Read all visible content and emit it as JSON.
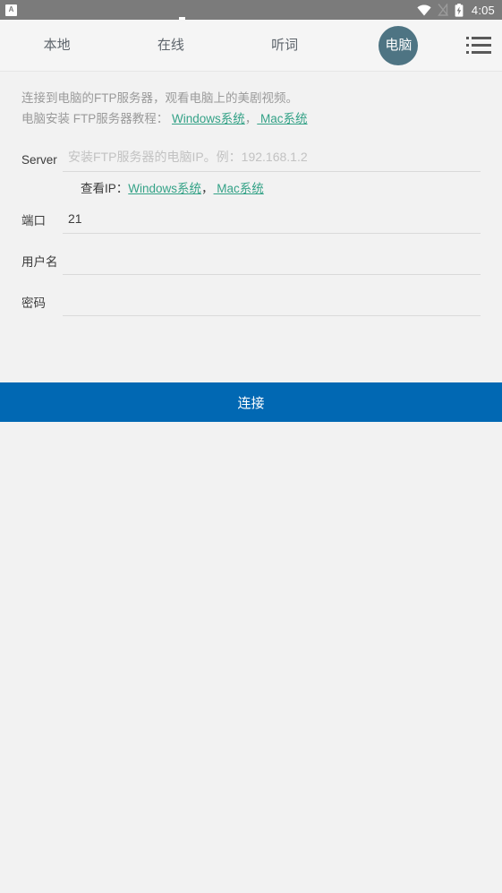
{
  "status_bar": {
    "app_icon": "app-notification-icon",
    "wifi_icon": "wifi-icon",
    "signal_icon": "signal-off-icon",
    "battery_icon": "battery-charging-icon",
    "time": "4:05"
  },
  "toolbar": {
    "tabs": [
      {
        "label": "本地",
        "name": "tab-local",
        "active": false
      },
      {
        "label": "在线",
        "name": "tab-online",
        "active": false
      },
      {
        "label": "听词",
        "name": "tab-listen",
        "active": false
      },
      {
        "label": "电脑",
        "name": "tab-computer",
        "active": true
      }
    ],
    "menu_icon": "hamburger-list-icon"
  },
  "intro": {
    "line1": "连接到电脑的FTP服务器，观看电脑上的美剧视频。",
    "line2_prefix": "电脑安装 FTP服务器教程：",
    "line2_link1": "Windows系统",
    "line2_separator": "，",
    "line2_link2": " Mac系统"
  },
  "form": {
    "server": {
      "label": "Server",
      "value": "",
      "placeholder": "安装FTP服务器的电脑IP。例：192.168.1.2"
    },
    "server_note": {
      "prefix": "查看IP：",
      "link1": "Windows系统",
      "separator": "，",
      "link2": " Mac系统"
    },
    "port": {
      "label": "端口",
      "value": "21",
      "placeholder": ""
    },
    "username": {
      "label": "用户名",
      "value": "",
      "placeholder": ""
    },
    "password": {
      "label": "密码",
      "value": "",
      "placeholder": ""
    }
  },
  "actions": {
    "connect_label": "连接"
  },
  "colors": {
    "accent_blue": "#0168b3",
    "link_teal": "#34a287",
    "avatar_slate": "#4e7483",
    "page_bg": "#f2f2f2",
    "statusbar_gray": "#7b7b7b"
  }
}
